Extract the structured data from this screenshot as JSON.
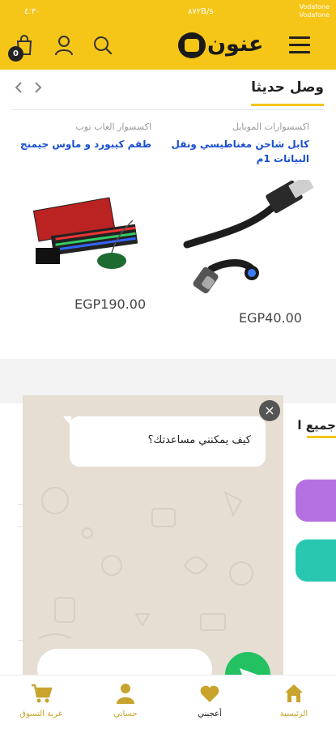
{
  "status_bar": {
    "time": "٤:٣٠",
    "network_speed": "٨٧٢B/s",
    "carrier_1": "Vodafone",
    "carrier_2": "Vodafone"
  },
  "header": {
    "logo_text": "عنون",
    "cart_count": "0"
  },
  "recent": {
    "title": "وصل حديثا"
  },
  "products": [
    {
      "category": "اكسسوارات الموبايل",
      "name": "كابل شاحن مغناطيسي ونقل البيانات 1م",
      "price": "EGP40.00"
    },
    {
      "category": "اكسسوار العاب توب",
      "name": "طقم كيبورد و ماوس جيمنج",
      "price": "EGP190.00"
    }
  ],
  "all_section": {
    "title": "جميع ا"
  },
  "chat_popup": {
    "message": "كيف يمكنني مساعدتك؟",
    "close_symbol": "×"
  },
  "bottom_nav": [
    {
      "label": "الرئيسية",
      "icon": "home-icon"
    },
    {
      "label": "أعجبني",
      "icon": "heart-icon"
    },
    {
      "label": "حسابي",
      "icon": "user-icon"
    },
    {
      "label": "عربة التسوق",
      "icon": "cart-icon"
    }
  ],
  "colors": {
    "brand_yellow": "#f5c518",
    "link_blue": "#1a4fd1",
    "whatsapp_green": "#23c161",
    "nav_gold": "#c8a42e"
  }
}
